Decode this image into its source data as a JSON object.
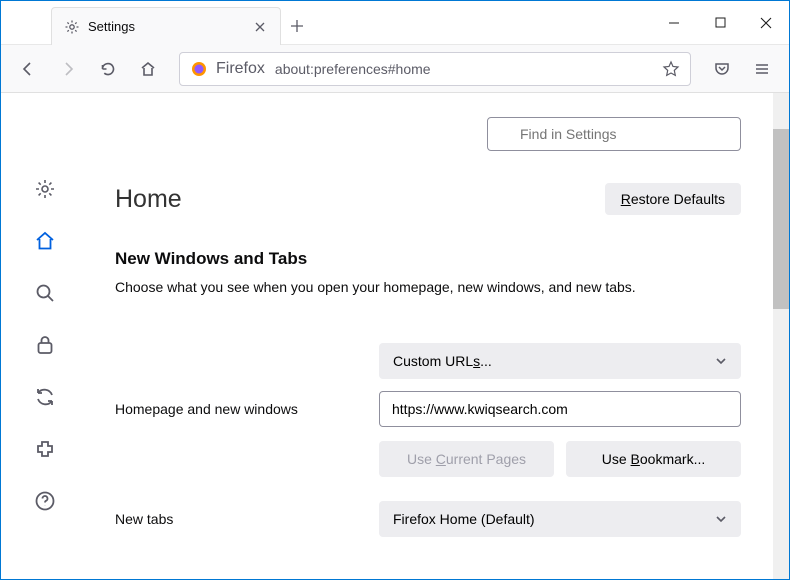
{
  "tab": {
    "title": "Settings"
  },
  "urlbar": {
    "prefix": "Firefox",
    "path": "about:preferences#home"
  },
  "search": {
    "placeholder": "Find in Settings"
  },
  "page": {
    "title": "Home",
    "restore": "estore Defaults",
    "section_title": "New Windows and Tabs",
    "description": "Choose what you see when you open your homepage, new windows, and new tabs."
  },
  "homepage": {
    "label": "Homepage and new windows",
    "dropdown": "Custom URL",
    "dropdown_suffix": "...",
    "url_value": "https://www.kwiqsearch.com",
    "use_current": "urrent Pages",
    "use_bookmark": "ookmark..."
  },
  "newtabs": {
    "label": "New tabs",
    "dropdown": "Firefox Home (Default)"
  }
}
